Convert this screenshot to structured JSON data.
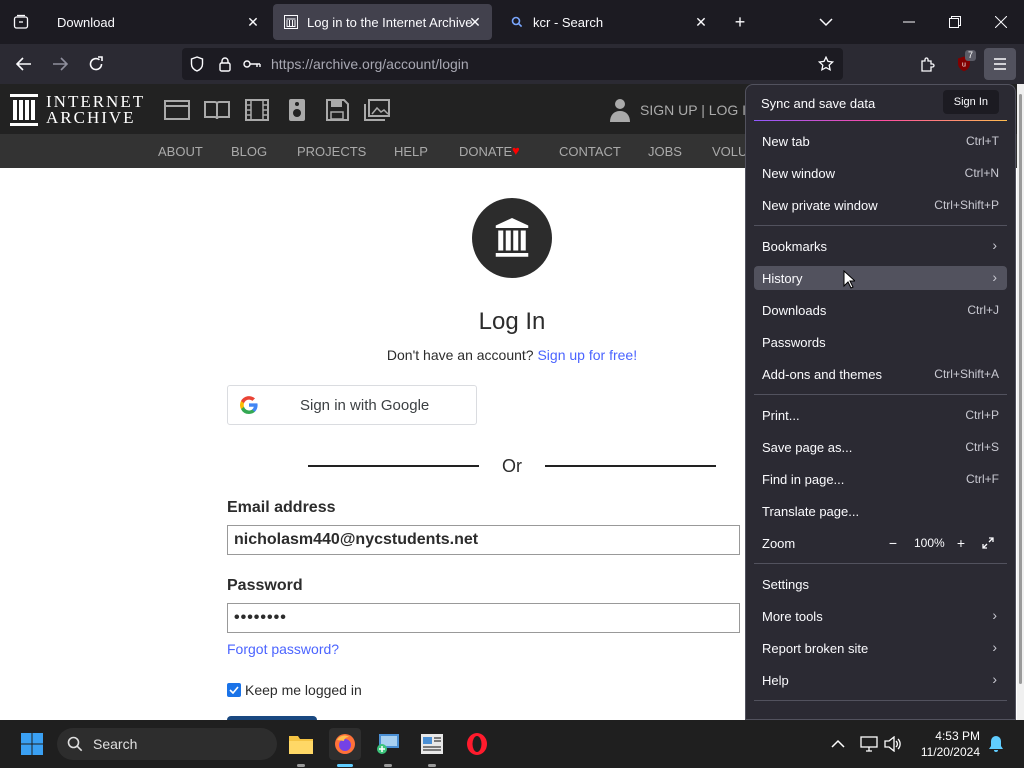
{
  "browser": {
    "tabs": [
      {
        "title": "Download",
        "active": false
      },
      {
        "title": "Log in to the Internet Archive",
        "active": true
      },
      {
        "title": "kcr - Search",
        "active": false
      }
    ],
    "url": {
      "domain": "https://archive.org",
      "path": "/account/login"
    },
    "extension_badge": "7"
  },
  "archive_header": {
    "logo_line1": "INTERNET",
    "logo_line2": "ARCHIVE",
    "auth_links": "SIGN UP | LOG IN"
  },
  "archive_nav": [
    "ABOUT",
    "BLOG",
    "PROJECTS",
    "HELP",
    "DONATE",
    "CONTACT",
    "JOBS",
    "VOLU"
  ],
  "login": {
    "title": "Log In",
    "no_account": "Don't have an account?",
    "signup_link": "Sign up for free!",
    "google_button": "Sign in with Google",
    "or": "Or",
    "email_label": "Email address",
    "email_value": "nicholasm440@nycstudents.net",
    "password_label": "Password",
    "password_value": "••••••••",
    "forgot": "Forgot password?",
    "keep_logged_in": "Keep me logged in"
  },
  "app_menu": {
    "sync_label": "Sync and save data",
    "sign_in": "Sign In",
    "items": [
      {
        "label": "New tab",
        "shortcut": "Ctrl+T"
      },
      {
        "label": "New window",
        "shortcut": "Ctrl+N"
      },
      {
        "label": "New private window",
        "shortcut": "Ctrl+Shift+P"
      },
      {
        "label": "Bookmarks",
        "submenu": true
      },
      {
        "label": "History",
        "submenu": true
      },
      {
        "label": "Downloads",
        "shortcut": "Ctrl+J"
      },
      {
        "label": "Passwords"
      },
      {
        "label": "Add-ons and themes",
        "shortcut": "Ctrl+Shift+A"
      },
      {
        "label": "Print...",
        "shortcut": "Ctrl+P"
      },
      {
        "label": "Save page as...",
        "shortcut": "Ctrl+S"
      },
      {
        "label": "Find in page...",
        "shortcut": "Ctrl+F"
      },
      {
        "label": "Translate page..."
      },
      {
        "label": "Zoom"
      },
      {
        "label": "Settings"
      },
      {
        "label": "More tools",
        "submenu": true
      },
      {
        "label": "Report broken site",
        "submenu": true
      },
      {
        "label": "Help",
        "submenu": true
      }
    ],
    "zoom_value": "100%",
    "hovered_item": "History"
  },
  "taskbar": {
    "search": "Search",
    "time": "4:53 PM",
    "date": "11/20/2024"
  },
  "colors": {
    "accent_link": "#4b64ff",
    "menu_bg": "#2b2a33",
    "menu_hover": "#52525e",
    "tabstrip_bg": "#1c1b22"
  }
}
